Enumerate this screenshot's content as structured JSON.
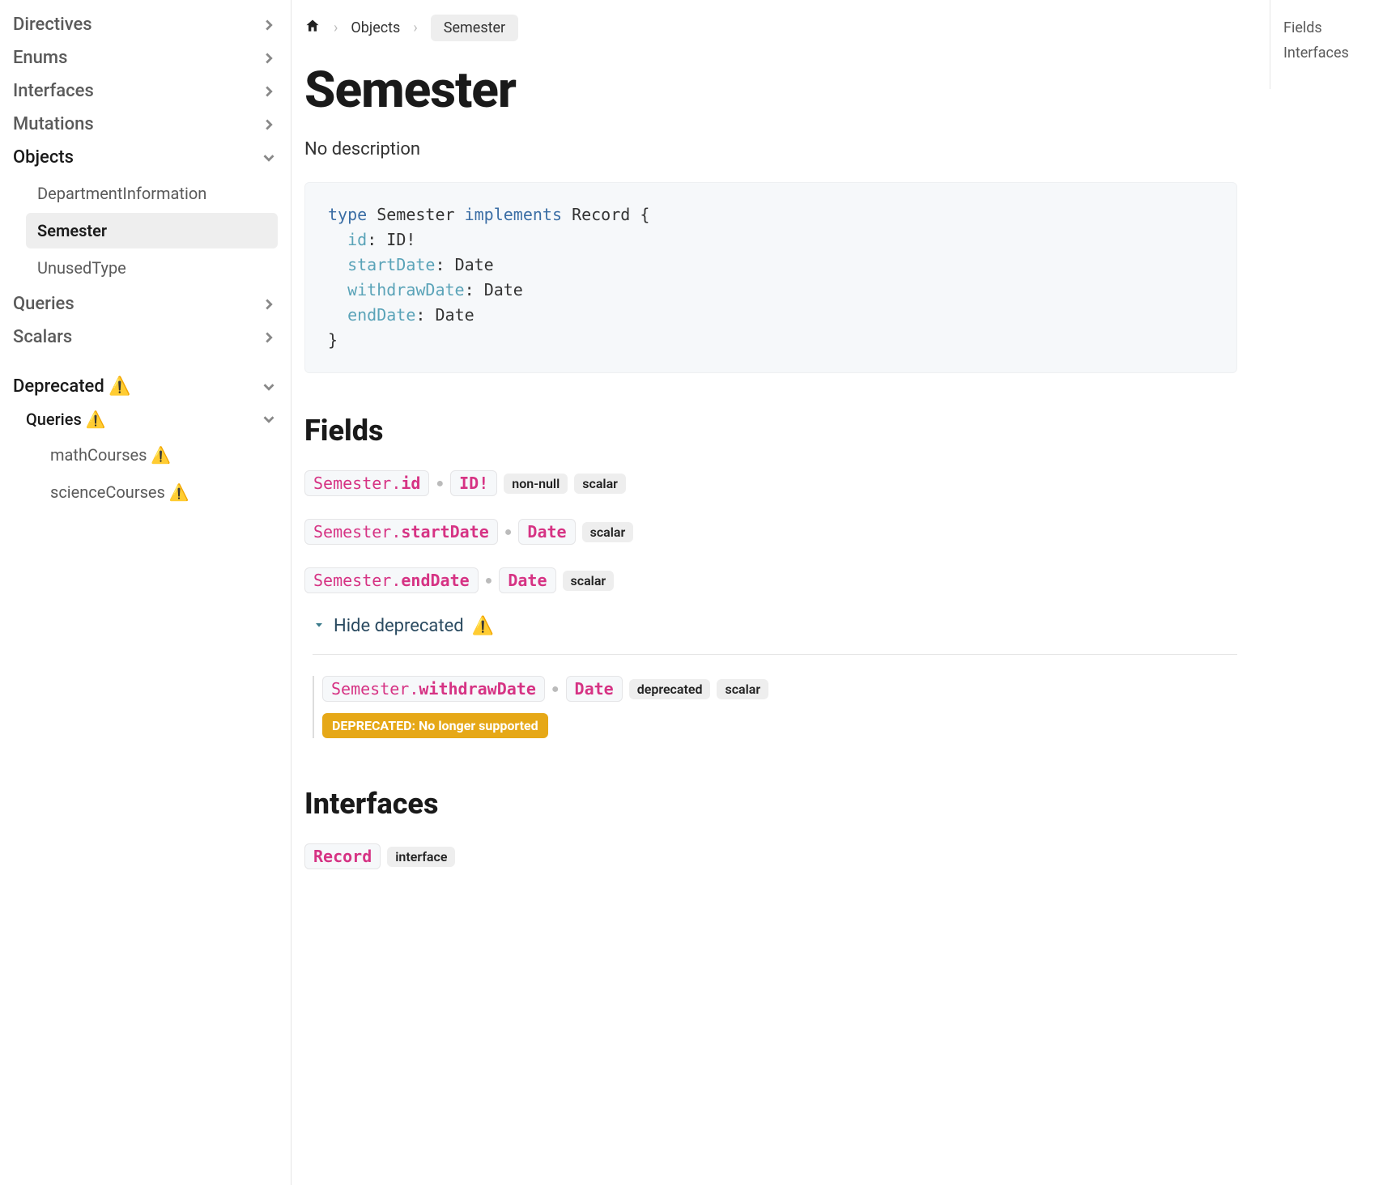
{
  "sidebar": {
    "groups": [
      {
        "label": "Directives",
        "expanded": false
      },
      {
        "label": "Enums",
        "expanded": false
      },
      {
        "label": "Interfaces",
        "expanded": false
      },
      {
        "label": "Mutations",
        "expanded": false
      },
      {
        "label": "Objects",
        "expanded": true,
        "items": [
          {
            "label": "DepartmentInformation",
            "active": false
          },
          {
            "label": "Semester",
            "active": true
          },
          {
            "label": "UnusedType",
            "active": false
          }
        ]
      },
      {
        "label": "Queries",
        "expanded": false
      },
      {
        "label": "Scalars",
        "expanded": false
      }
    ],
    "deprecated": {
      "label": "Deprecated",
      "queries_label": "Queries",
      "items": [
        {
          "label": "mathCourses"
        },
        {
          "label": "scienceCourses"
        }
      ]
    }
  },
  "breadcrumb": {
    "items": [
      "Objects",
      "Semester"
    ]
  },
  "page": {
    "title": "Semester",
    "description": "No description"
  },
  "code": {
    "keyword_type": "type",
    "typename": "Semester",
    "keyword_implements": "implements",
    "interface": "Record",
    "fields": {
      "id": {
        "name": "id",
        "type": "ID!"
      },
      "startDate": {
        "name": "startDate",
        "type": "Date"
      },
      "withdrawDate": {
        "name": "withdrawDate",
        "type": "Date"
      },
      "endDate": {
        "name": "endDate",
        "type": "Date"
      }
    }
  },
  "sections": {
    "fields": "Fields",
    "interfaces": "Interfaces"
  },
  "fields": [
    {
      "parent": "Semester",
      "member": "id",
      "type": "ID!",
      "badges": [
        "non-null",
        "scalar"
      ]
    },
    {
      "parent": "Semester",
      "member": "startDate",
      "type": "Date",
      "badges": [
        "scalar"
      ]
    },
    {
      "parent": "Semester",
      "member": "endDate",
      "type": "Date",
      "badges": [
        "scalar"
      ]
    }
  ],
  "deprecated_toggle": "Hide deprecated",
  "deprecated_field": {
    "parent": "Semester",
    "member": "withdrawDate",
    "type": "Date",
    "badges": [
      "deprecated",
      "scalar"
    ],
    "message": "DEPRECATED: No longer supported"
  },
  "interfaces_list": [
    {
      "name": "Record",
      "badge": "interface"
    }
  ],
  "toc": {
    "items": [
      "Fields",
      "Interfaces"
    ]
  },
  "badges_text": {
    "nonnull": "non-null",
    "scalar": "scalar",
    "deprecated": "deprecated",
    "interface": "interface"
  }
}
